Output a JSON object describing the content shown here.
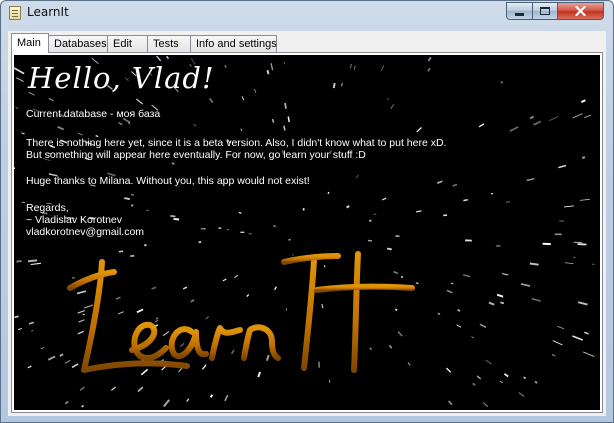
{
  "window": {
    "title": "LearnIt",
    "controls": {
      "minimize": "minimize-icon",
      "maximize": "maximize-icon",
      "close": "close-icon"
    }
  },
  "tabs": [
    "Main",
    "Databases",
    "Edit",
    "Tests",
    "Info and settings"
  ],
  "main": {
    "greeting": "Hello, Vlad!",
    "current_database": "Current database - моя база",
    "beta_note": "There is nothing here yet, since it is a beta version. Also, I didn't know what to put here xD.",
    "eventually_note": "But something will appear here eventually. For now, go learn your stuff :D",
    "thanks": "Huge thanks to Milana. Without you, this app would not exist!",
    "regards": "Regards,",
    "author": "~ Vladislav Korotnev",
    "email": "vladkorotnev@gmail.com",
    "logo_text": "LearnIt"
  },
  "colors": {
    "background": "#000000",
    "text": "#ffffff",
    "logo_orange": "#e08a00"
  }
}
